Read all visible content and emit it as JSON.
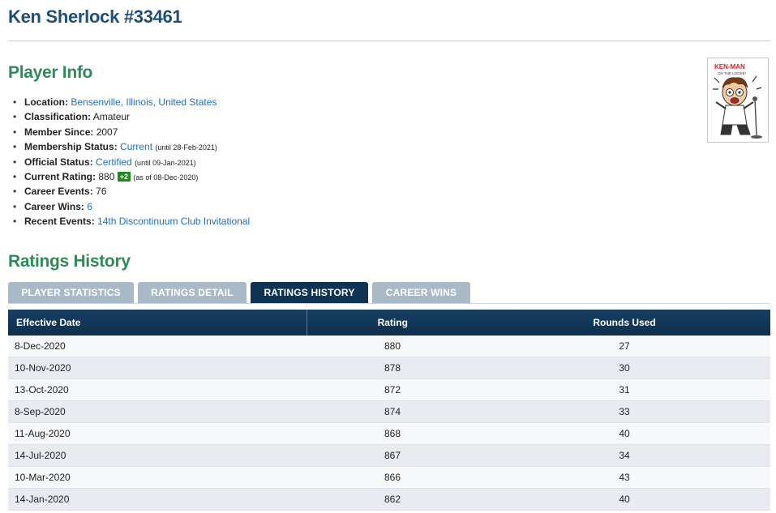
{
  "header": {
    "title": "Ken Sherlock #33461"
  },
  "player_info": {
    "heading": "Player Info",
    "location_label": "Location:",
    "location_value": "Bensenville, Illinois, United States",
    "classification_label": "Classification:",
    "classification_value": "Amateur",
    "member_since_label": "Member Since:",
    "member_since_value": "2007",
    "membership_label": "Membership Status:",
    "membership_value": "Current",
    "membership_note": "(until 28-Feb-2021)",
    "official_label": "Official Status:",
    "official_value": "Certified",
    "official_note": "(until 09-Jan-2021)",
    "rating_label": "Current Rating:",
    "rating_value": "880",
    "rating_change": "+2",
    "rating_note": "(as of 08-Dec-2020)",
    "events_label": "Career Events:",
    "events_value": "76",
    "wins_label": "Career Wins:",
    "wins_value": "6",
    "recent_label": "Recent Events:",
    "recent_value": "14th Discontinuum Club Invitational"
  },
  "avatar": {
    "caption_top": "KEN-MAN",
    "caption_sub": "ON THE LOOSE!"
  },
  "ratings_history": {
    "heading": "Ratings History",
    "tabs": [
      {
        "label": "PLAYER STATISTICS",
        "active": false
      },
      {
        "label": "RATINGS DETAIL",
        "active": false
      },
      {
        "label": "RATINGS HISTORY",
        "active": true
      },
      {
        "label": "CAREER WINS",
        "active": false
      }
    ],
    "columns": [
      "Effective Date",
      "Rating",
      "Rounds Used"
    ],
    "rows": [
      {
        "date": "8-Dec-2020",
        "rating": "880",
        "rounds": "27"
      },
      {
        "date": "10-Nov-2020",
        "rating": "878",
        "rounds": "30"
      },
      {
        "date": "13-Oct-2020",
        "rating": "872",
        "rounds": "31"
      },
      {
        "date": "8-Sep-2020",
        "rating": "874",
        "rounds": "33"
      },
      {
        "date": "11-Aug-2020",
        "rating": "868",
        "rounds": "40"
      },
      {
        "date": "14-Jul-2020",
        "rating": "867",
        "rounds": "34"
      },
      {
        "date": "10-Mar-2020",
        "rating": "866",
        "rounds": "43"
      },
      {
        "date": "14-Jan-2020",
        "rating": "862",
        "rounds": "40"
      }
    ]
  },
  "colors": {
    "title": "#1f4e79",
    "section_heading": "#2e8b57",
    "link": "#1f6fb5",
    "tab_inactive": "#a9b9c7",
    "tab_active": "#0f3353",
    "table_header": "#0e2f4c",
    "badge": "#1e8a1e"
  }
}
